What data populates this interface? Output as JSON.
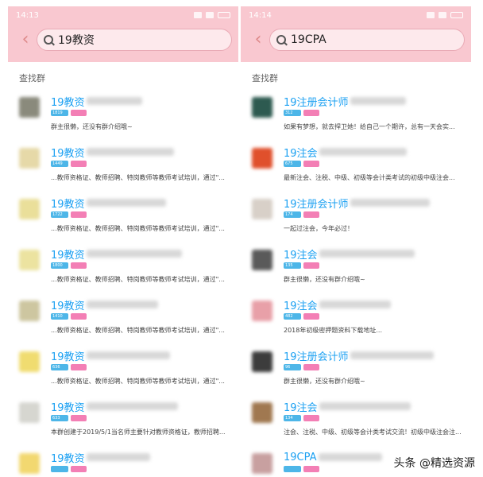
{
  "left": {
    "status_time": "14:13",
    "query": "19教资",
    "section_label": "查找群",
    "items": [
      {
        "title": "19教资",
        "tag_count": "1819",
        "desc": "群主很懒，还没有群介绍哦~",
        "avatar": "#8a8a7c"
      },
      {
        "title": "19教资",
        "tag_count": "1449",
        "desc": "...教师资格证、教师招聘、特岗教师等教师考试培训，通过\"...",
        "avatar": "#e6d9a8"
      },
      {
        "title": "19教资",
        "tag_count": "1722",
        "desc": "...教师资格证、教师招聘、特岗教师等教师考试培训，通过\"...",
        "avatar": "#eadf9a"
      },
      {
        "title": "19教资",
        "tag_count": "1800",
        "desc": "...教师资格证、教师招聘、特岗教师等教师考试培训，通过\"...",
        "avatar": "#ece3a0"
      },
      {
        "title": "19教资",
        "tag_count": "1410",
        "desc": "...教师资格证、教师招聘、特岗教师等教师考试培训，通过\"...",
        "avatar": "#cdc6a0"
      },
      {
        "title": "19教资",
        "tag_count": "636",
        "desc": "...教师资格证、教师招聘、特岗教师等教师考试培训，通过\"...",
        "avatar": "#f0dc70"
      },
      {
        "title": "19教资",
        "tag_count": "633",
        "desc": "本群创建于2019/5/1当名师主要针对教师资格证，教师招聘...",
        "avatar": "#d6d6d0"
      },
      {
        "title": "19教资",
        "tag_count": "",
        "desc": "",
        "avatar": "#f2d870"
      }
    ]
  },
  "right": {
    "status_time": "14:14",
    "query": "19CPA",
    "section_label": "查找群",
    "items": [
      {
        "title": "19注册会计师",
        "tag_count": "312",
        "desc": "如果有梦想，就去捍卫她！给自己一个期许，总有一天会实...",
        "avatar": "#2d5a50"
      },
      {
        "title": "19注会",
        "tag_count": "675",
        "desc": "最新注会、注税、中级、初级等会计类考试的初级中级注会...",
        "avatar": "#e0502c"
      },
      {
        "title": "19注册会计师",
        "tag_count": "174",
        "desc": "一起过注会，今年必过！",
        "avatar": "#d8d0c8"
      },
      {
        "title": "19注会",
        "tag_count": "135",
        "desc": "群主很懒，还没有群介绍哦~",
        "avatar": "#5a5a5a"
      },
      {
        "title": "19注会",
        "tag_count": "482",
        "desc": "2018年初级密押题资料下载地址...",
        "avatar": "#e8a0a8"
      },
      {
        "title": "19注册会计师",
        "tag_count": "96",
        "desc": "群主很懒，还没有群介绍哦~",
        "avatar": "#3c3c3c"
      },
      {
        "title": "19注会",
        "tag_count": "134",
        "desc": "注会、注税、中级、初级等会计类考试交流！初级中级注会注...",
        "avatar": "#a07850"
      },
      {
        "title": "19CPA",
        "tag_count": "",
        "desc": "",
        "avatar": "#c8a0a0"
      }
    ]
  },
  "watermark": "头条 @精选资源"
}
